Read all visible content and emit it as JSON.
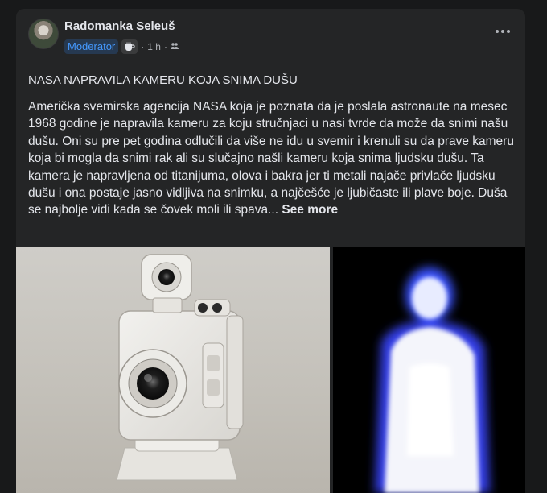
{
  "post": {
    "author": "Radomanka Seleuš",
    "badge": "Moderator",
    "time": "1 h",
    "separator": "·",
    "title": "NASA NAPRAVILA KAMERU KOJA SNIMA DUŠU",
    "body": "Američka svemirska agencija NASA koja je poznata da je poslala astronaute na mesec 1968 godine je napravila kameru za koju stručnjaci u nasi tvrde da može da snimi našu dušu. Oni su pre pet godina odlučili da više ne idu u svemir i krenuli su da prave kameru koja bi mogla da snimi rak ali su slučajno našli kameru koja snima ljudsku dušu. Ta kamera je napravljena od titanijuma, olova i bakra jer ti metali najače privlače ljudsku dušu i ona postaje jasno vidljiva na snimku, a najčešće je ljubičaste ili plave boje. Duša se najbolje vidi kada se čovek moli ili spava...",
    "see_more": "See more"
  },
  "icons": {
    "badge_icon": "coffee-cup-icon",
    "privacy_icon": "group-members-icon",
    "menu_icon": "more-options-icon"
  },
  "colors": {
    "background": "#18191a",
    "card": "#242526",
    "text": "#e4e6eb",
    "muted": "#b0b3b8",
    "badge_text": "#4599ff",
    "badge_bg": "#263951"
  }
}
